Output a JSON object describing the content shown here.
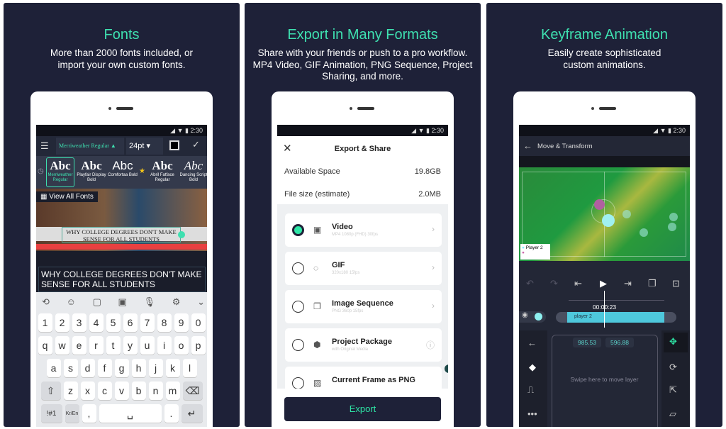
{
  "panels": [
    {
      "title": "Fonts",
      "subtitle": "More than 2000 fonts included, or import your own custom fonts."
    },
    {
      "title": "Export in Many Formats",
      "subtitle": "Share with your friends or push to a pro workflow. MP4 Video, GIF Animation, PNG Sequence, Project Sharing, and more."
    },
    {
      "title": "Keyframe Animation",
      "subtitle": "Easily create sophisticated custom animations."
    }
  ],
  "status_time": "2:30",
  "fonts_screen": {
    "font_selector": "Merriweather Regular",
    "size": "24pt",
    "fonts": [
      {
        "sample": "Abc",
        "name": "Merriweather Regular"
      },
      {
        "sample": "Abc",
        "name": "Playfair Display Bold"
      },
      {
        "sample": "Abc",
        "name": "Comfortaa Bold"
      },
      {
        "sample": "Abc",
        "name": "Abril Fatface Regular"
      },
      {
        "sample": "Abc",
        "name": "Dancing Script Bold"
      }
    ],
    "view_all": "View All Fonts",
    "overlay_text": "WHY COLLEGE DEGREES DON'T MAKE SENSE FOR ALL STUDENTS",
    "input_text": "WHY COLLEGE DEGREES DON'T MAKE SENSE FOR ALL STUDENTS",
    "keyboard": {
      "row1": [
        "1",
        "2",
        "3",
        "4",
        "5",
        "6",
        "7",
        "8",
        "9",
        "0"
      ],
      "row2": [
        "q",
        "w",
        "e",
        "r",
        "t",
        "y",
        "u",
        "i",
        "o",
        "p"
      ],
      "row3": [
        "a",
        "s",
        "d",
        "f",
        "g",
        "h",
        "j",
        "k",
        "l"
      ],
      "row4": [
        "z",
        "x",
        "c",
        "v",
        "b",
        "n",
        "m"
      ],
      "sym": "!#1",
      "lang": "Kr/En",
      "comma": ",",
      "period": "."
    }
  },
  "export_screen": {
    "title": "Export & Share",
    "available_label": "Available Space",
    "available_value": "19.8GB",
    "filesize_label": "File size (estimate)",
    "filesize_value": "2.0MB",
    "options": [
      {
        "title": "Video",
        "subtitle": "MP4 1080p (FHD) 30fps",
        "icon": "film-icon",
        "selected": true
      },
      {
        "title": "GIF",
        "subtitle": "320x180 15fps",
        "icon": "gif-icon",
        "selected": false
      },
      {
        "title": "Image Sequence",
        "subtitle": "PNG 360p 15fps",
        "icon": "images-icon",
        "selected": false
      },
      {
        "title": "Project Package",
        "subtitle": "with Original Media",
        "icon": "package-icon",
        "selected": false
      },
      {
        "title": "Current Frame as PNG",
        "subtitle": "",
        "icon": "image-icon",
        "selected": false
      }
    ],
    "export_button": "Export",
    "accent": "#2ee6a6"
  },
  "keyframe_screen": {
    "title": "Move & Transform",
    "legend_label": "Player 2",
    "timecode": "00:00:23",
    "layer_name": "player 2",
    "x_value": "985.53",
    "y_value": "596.88",
    "swipe_hint": "Swipe here to move layer"
  }
}
